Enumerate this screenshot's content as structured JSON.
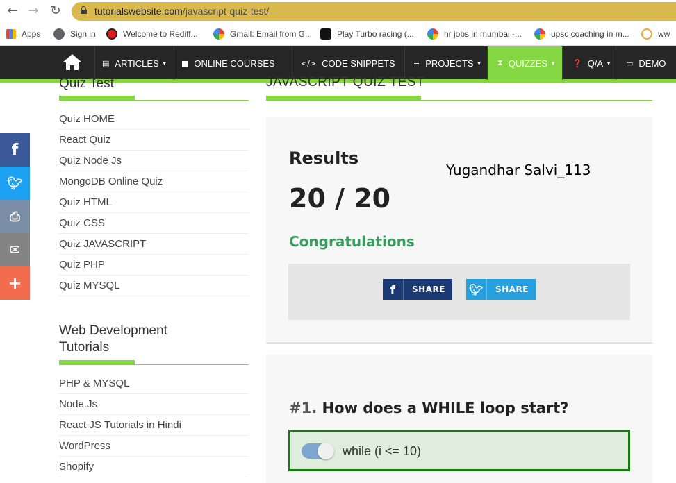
{
  "browser": {
    "url_host": "tutorialswebsite.com",
    "url_path": "/javascript-quiz-test/",
    "bookmarks": [
      {
        "label": "Apps",
        "icon": "apps-icon"
      },
      {
        "label": "Sign in",
        "icon": "globe-icon"
      },
      {
        "label": "Welcome to Rediff...",
        "icon": "rediff-icon"
      },
      {
        "label": "Gmail: Email from G...",
        "icon": "google-icon"
      },
      {
        "label": "Play Turbo racing (...",
        "icon": "turbo-icon"
      },
      {
        "label": "hr jobs in mumbai -...",
        "icon": "google-icon"
      },
      {
        "label": "upsc coaching in m...",
        "icon": "google-icon"
      },
      {
        "label": "ww",
        "icon": "arrow-icon"
      }
    ]
  },
  "site_nav": {
    "items": [
      {
        "label": "ARTICLES",
        "icon": "document-icon",
        "caret": true
      },
      {
        "label": "ONLINE COURSES",
        "icon": "video-icon",
        "caret": false
      },
      {
        "label": "CODE SNIPPETS",
        "icon": "code-icon",
        "caret": false
      },
      {
        "label": "PROJECTS",
        "icon": "stack-icon",
        "caret": true
      },
      {
        "label": "QUIZZES",
        "icon": "hourglass-icon",
        "caret": true
      },
      {
        "label": "Q/A",
        "icon": "question-icon",
        "caret": true
      },
      {
        "label": "DEMO",
        "icon": "laptop-icon",
        "caret": false
      }
    ],
    "active": "QUIZZES",
    "accent_color": "#84d642"
  },
  "social": [
    "facebook-icon",
    "twitter-icon",
    "print-icon",
    "mail-icon",
    "plus-icon"
  ],
  "sidebar": {
    "quiz_title": "Quiz Test",
    "quiz_links": [
      "Quiz HOME",
      "React Quiz",
      "Quiz Node Js",
      "MongoDB Online Quiz",
      "Quiz HTML",
      "Quiz CSS",
      "Quiz JAVASCRIPT",
      "Quiz PHP",
      "Quiz MYSQL"
    ],
    "web_title_line1": "Web Development",
    "web_title_line2": "Tutorials",
    "web_links": [
      "PHP & MYSQL",
      "Node.Js",
      "React JS Tutorials in Hindi",
      "WordPress",
      "Shopify"
    ]
  },
  "main": {
    "title": "JAVASCRIPT QUIZ TEST",
    "results_label": "Results",
    "handwritten_note": "Yugandhar Salvi_113",
    "score": "20 / 20",
    "congrats": "Congratulations",
    "share_fb": "SHARE",
    "share_tw": "SHARE",
    "question_number": "#1.",
    "question_text": "How does a WHILE loop start?",
    "answer_text": "while (i <= 10)",
    "answer_selected": true,
    "correct_color": "#1a7a12"
  }
}
